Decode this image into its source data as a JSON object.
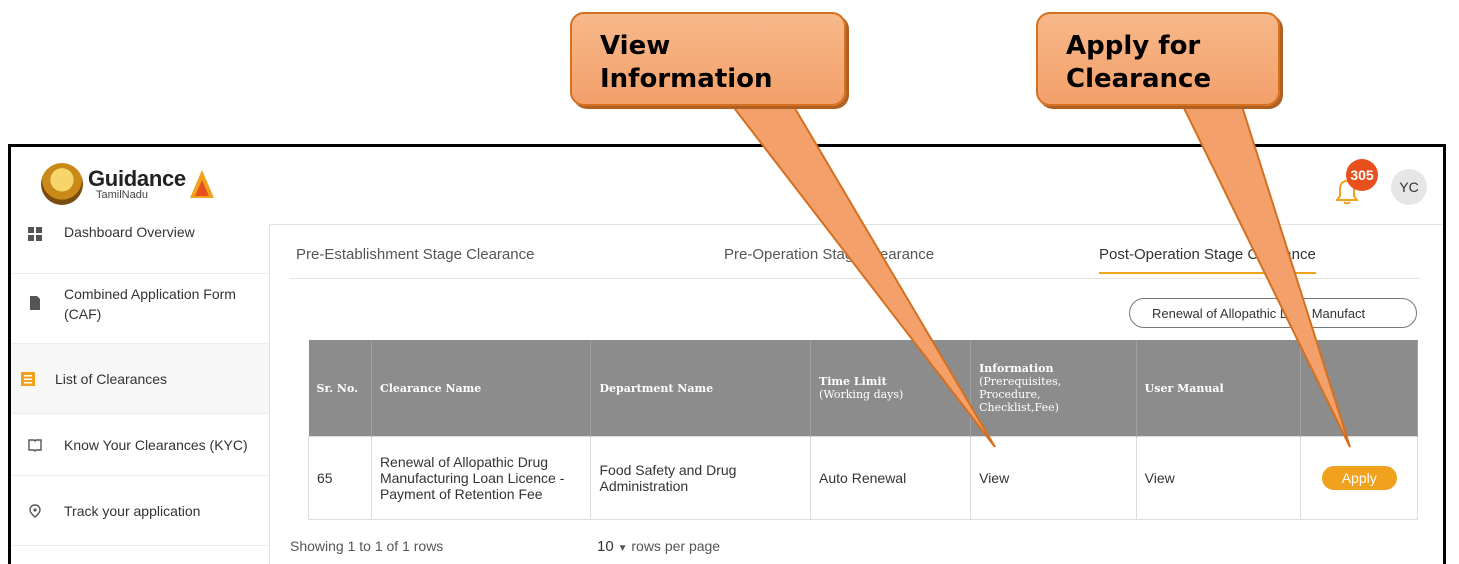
{
  "callouts": {
    "view_info": "View\nInformation",
    "apply": "Apply for\nClearance"
  },
  "header": {
    "logo_main": "Guidance",
    "logo_sub": "TamilNadu",
    "notification_count": "305",
    "avatar_initials": "YC"
  },
  "sidebar": {
    "items": [
      {
        "label": "Dashboard Overview",
        "icon": "grid-icon"
      },
      {
        "label": "Combined Application Form (CAF)",
        "icon": "file-icon"
      },
      {
        "label": "List of Clearances",
        "icon": "list-icon"
      },
      {
        "label": "Know Your Clearances (KYC)",
        "icon": "book-icon"
      },
      {
        "label": "Track your application",
        "icon": "location-icon"
      }
    ]
  },
  "tabs": [
    {
      "label": "Pre-Establishment Stage Clearance"
    },
    {
      "label": "Pre-Operation Stage Clearance"
    },
    {
      "label": "Post-Operation Stage Clearance"
    }
  ],
  "search_pill": "Renewal of Allopathic Drug Manufact",
  "table": {
    "headers": {
      "sr_no": "Sr. No.",
      "clearance_name": "Clearance Name",
      "department_name": "Department Name",
      "time_limit": "Time Limit",
      "time_limit_sub": "(Working days)",
      "information": "Information",
      "information_sub": "(Prerequisites, Procedure, Checklist,Fee)",
      "user_manual": "User Manual"
    },
    "rows": [
      {
        "sr_no": "65",
        "clearance_name": "Renewal of Allopathic Drug Manufacturing Loan Licence - Payment of Retention Fee",
        "department_name": "Food Safety and Drug Administration",
        "time_limit": "Auto Renewal",
        "information": "View",
        "user_manual": "View",
        "action": "Apply"
      }
    ]
  },
  "footer": {
    "showing": "Showing 1 to 1 of 1 rows",
    "rows_per_page_value": "10",
    "rows_per_page_label": "rows per page"
  },
  "colors": {
    "accent": "#f0a21e",
    "badge": "#e8501e",
    "table_header": "#8c8c8c",
    "callout": "#f3a06a"
  }
}
